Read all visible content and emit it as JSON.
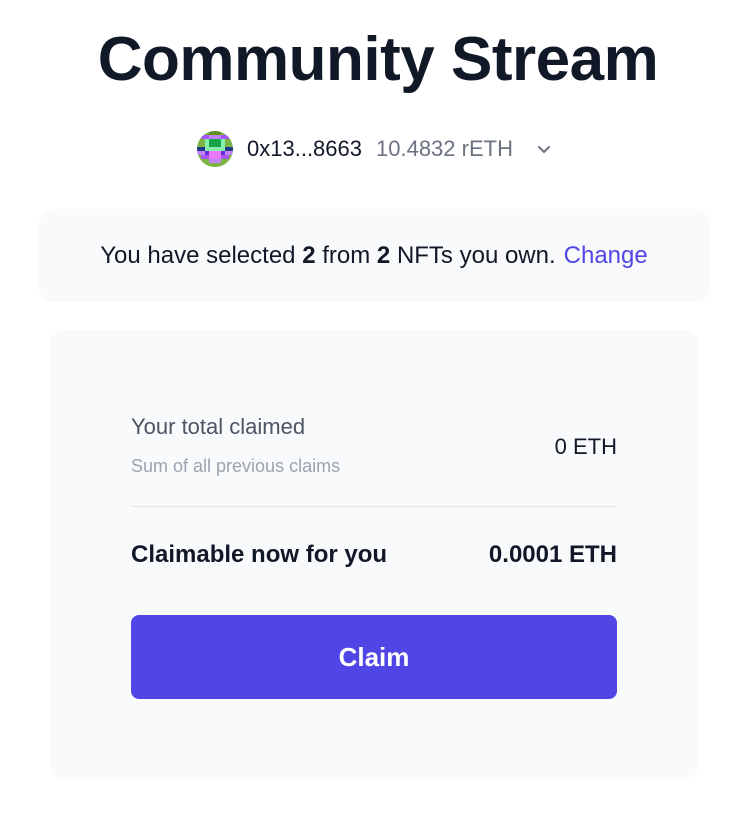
{
  "header": {
    "title": "Community Stream"
  },
  "account": {
    "avatar_icon": "pixel-avatar-icon",
    "address": "0x13...8663",
    "balance": "10.4832 rETH",
    "dropdown_icon": "chevron-down-icon"
  },
  "selection": {
    "prefix": "You have selected",
    "selected_count": "2",
    "middle": "from",
    "owned_count": "2",
    "suffix": "NFTs you own.",
    "change_label": "Change"
  },
  "claim_card": {
    "total_label": "Your total claimed",
    "total_sub": "Sum of all previous claims",
    "total_value": "0 ETH",
    "claimable_label": "Claimable now for you",
    "claimable_value": "0.0001 ETH",
    "claim_button": "Claim"
  },
  "colors": {
    "accent": "#4f46e5",
    "card_bg": "#f9fafb",
    "text_primary": "#111827",
    "text_muted": "#6b7280"
  }
}
